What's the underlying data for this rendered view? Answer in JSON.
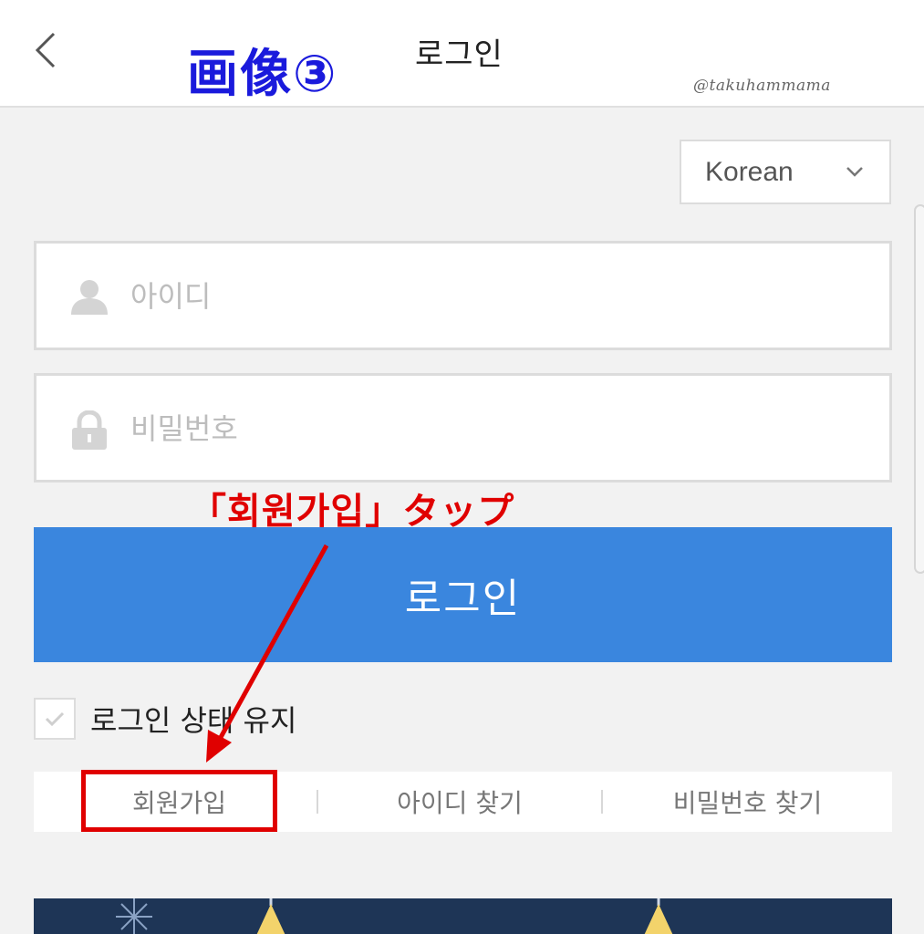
{
  "header": {
    "title": "로그인",
    "overlay_label": "画像③",
    "watermark": "@takuhammama"
  },
  "language_select": {
    "value": "Korean"
  },
  "form": {
    "id_placeholder": "아이디",
    "password_placeholder": "비밀번호",
    "login_button": "로그인",
    "keep_logged_in": "로그인 상태 유지"
  },
  "annotation": {
    "text": "「회원가입」タップ"
  },
  "links": {
    "signup": "회원가입",
    "find_id": "아이디 찾기",
    "find_password": "비밀번호 찾기"
  },
  "colors": {
    "accent": "#3a86de",
    "annotation": "#e00000",
    "overlay_label": "#1a1adc",
    "banner": "#1e3556"
  }
}
